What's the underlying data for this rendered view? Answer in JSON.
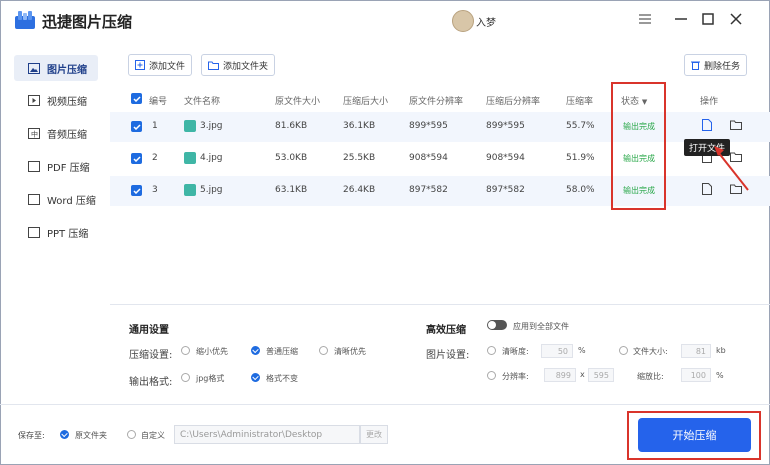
{
  "app": {
    "title": "迅捷图片压缩",
    "user": "入梦"
  },
  "sidebar": {
    "items": [
      {
        "label": "图片压缩",
        "icon": "image-icon"
      },
      {
        "label": "视频压缩",
        "icon": "video-icon"
      },
      {
        "label": "音频压缩",
        "icon": "audio-icon"
      },
      {
        "label": "PDF 压缩",
        "icon": "pdf-icon"
      },
      {
        "label": "Word 压缩",
        "icon": "word-icon"
      },
      {
        "label": "PPT 压缩",
        "icon": "ppt-icon"
      }
    ]
  },
  "toolbar": {
    "add_file": "添加文件",
    "add_folder": "添加文件夹",
    "delete_task": "删除任务"
  },
  "table": {
    "headers": {
      "no": "编号",
      "name": "文件名称",
      "orig_size": "原文件大小",
      "comp_size": "压缩后大小",
      "orig_res": "原文件分辨率",
      "comp_res": "压缩后分辨率",
      "ratio": "压缩率",
      "status": "状态",
      "ops": "操作"
    },
    "rows": [
      {
        "no": "1",
        "name": "3.jpg",
        "orig_size": "81.6KB",
        "comp_size": "36.1KB",
        "orig_res": "899*595",
        "comp_res": "899*595",
        "ratio": "55.7%",
        "status": "输出完成"
      },
      {
        "no": "2",
        "name": "4.jpg",
        "orig_size": "53.0KB",
        "comp_size": "25.5KB",
        "orig_res": "908*594",
        "comp_res": "908*594",
        "ratio": "51.9%",
        "status": "输出完成"
      },
      {
        "no": "3",
        "name": "5.jpg",
        "orig_size": "63.1KB",
        "comp_size": "26.4KB",
        "orig_res": "897*582",
        "comp_res": "897*582",
        "ratio": "58.0%",
        "status": "输出完成"
      }
    ]
  },
  "tooltip": "打开文件",
  "settings": {
    "general_title": "通用设置",
    "compress_label": "压缩设置:",
    "compress_options": [
      "缩小优先",
      "普通压缩",
      "清晰优先"
    ],
    "compress_selected": "普通压缩",
    "format_label": "输出格式:",
    "format_options": [
      "jpg格式",
      "格式不变"
    ],
    "format_selected": "格式不变",
    "efficient_title": "高效压缩",
    "apply_all": "应用到全部文件",
    "image_label": "图片设置:",
    "clarity_label": "清晰度:",
    "clarity_value": "50",
    "clarity_unit": "%",
    "filesize_label": "文件大小:",
    "filesize_value": "81",
    "filesize_unit": "kb",
    "resolution_label": "分辨率:",
    "res_w": "899",
    "res_x": "x",
    "res_h": "595",
    "scale_label": "缩放比:",
    "scale_value": "100",
    "scale_unit": "%"
  },
  "bottom": {
    "save_to": "保存至:",
    "orig_folder": "原文件夹",
    "custom": "自定义",
    "path": "C:\\Users\\Administrator\\Desktop",
    "change": "更改",
    "start": "开始压缩"
  },
  "colors": {
    "accent": "#2563eb",
    "status_ok": "#2aa84a",
    "highlight": "#d9342b"
  }
}
